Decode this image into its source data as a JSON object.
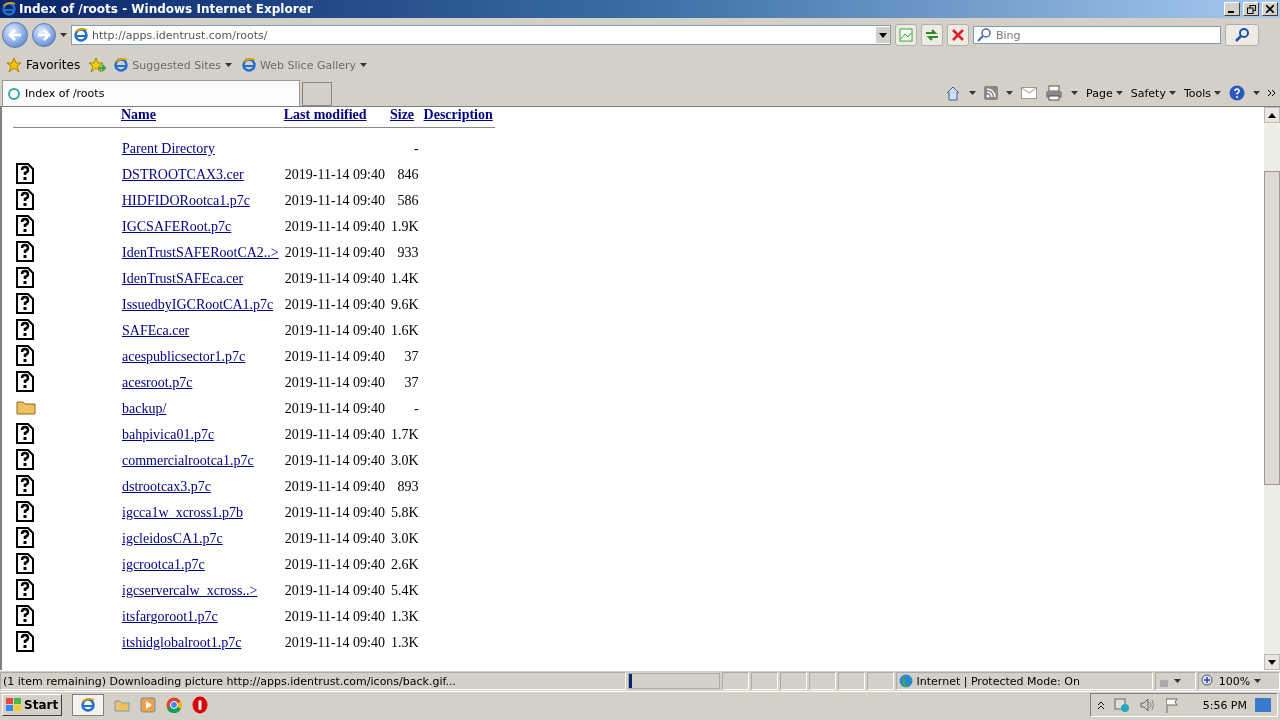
{
  "window": {
    "title": "Index of /roots - Windows Internet Explorer"
  },
  "address_bar": {
    "url": "http://apps.identrust.com/roots/"
  },
  "search": {
    "placeholder": "Bing"
  },
  "favorites_bar": {
    "favorites": "Favorites",
    "items": [
      {
        "label": "Suggested Sites"
      },
      {
        "label": "Web Slice Gallery"
      }
    ]
  },
  "tabs": [
    {
      "label": "Index of /roots",
      "selected": true
    }
  ],
  "command_bar": [
    "Page",
    "Safety",
    "Tools"
  ],
  "listing": {
    "columns": [
      "Name",
      "Last modified",
      "Size",
      "Description"
    ],
    "rows": [
      {
        "kind": "parent",
        "name": "Parent Directory",
        "modified": "",
        "size": "-"
      },
      {
        "kind": "file",
        "name": "DSTROOTCAX3.cer",
        "modified": "2019-11-14 09:40",
        "size": "846"
      },
      {
        "kind": "file",
        "name": "HIDFIDORootca1.p7c",
        "modified": "2019-11-14 09:40",
        "size": "586"
      },
      {
        "kind": "file",
        "name": "IGCSAFERoot.p7c",
        "modified": "2019-11-14 09:40",
        "size": "1.9K"
      },
      {
        "kind": "file",
        "name": "IdenTrustSAFERootCA2..>",
        "modified": "2019-11-14 09:40",
        "size": "933"
      },
      {
        "kind": "file",
        "name": "IdenTrustSAFEca.cer",
        "modified": "2019-11-14 09:40",
        "size": "1.4K"
      },
      {
        "kind": "file",
        "name": "IssuedbyIGCRootCA1.p7c",
        "modified": "2019-11-14 09:40",
        "size": "9.6K"
      },
      {
        "kind": "file",
        "name": "SAFEca.cer",
        "modified": "2019-11-14 09:40",
        "size": "1.6K"
      },
      {
        "kind": "file",
        "name": "acespublicsector1.p7c",
        "modified": "2019-11-14 09:40",
        "size": "37"
      },
      {
        "kind": "file",
        "name": "acesroot.p7c",
        "modified": "2019-11-14 09:40",
        "size": "37"
      },
      {
        "kind": "folder",
        "name": "backup/",
        "modified": "2019-11-14 09:40",
        "size": "-"
      },
      {
        "kind": "file",
        "name": "bahpivica01.p7c",
        "modified": "2019-11-14 09:40",
        "size": "1.7K"
      },
      {
        "kind": "file",
        "name": "commercialrootca1.p7c",
        "modified": "2019-11-14 09:40",
        "size": "3.0K"
      },
      {
        "kind": "file",
        "name": "dstrootcax3.p7c",
        "modified": "2019-11-14 09:40",
        "size": "893"
      },
      {
        "kind": "file",
        "name": "igcca1w_xcross1.p7b",
        "modified": "2019-11-14 09:40",
        "size": "5.8K"
      },
      {
        "kind": "file",
        "name": "igcleidosCA1.p7c",
        "modified": "2019-11-14 09:40",
        "size": "3.0K"
      },
      {
        "kind": "file",
        "name": "igcrootca1.p7c",
        "modified": "2019-11-14 09:40",
        "size": "2.6K"
      },
      {
        "kind": "file",
        "name": "igcservercalw_xcross..>",
        "modified": "2019-11-14 09:40",
        "size": "5.4K"
      },
      {
        "kind": "file",
        "name": "itsfargoroot1.p7c",
        "modified": "2019-11-14 09:40",
        "size": "1.3K"
      },
      {
        "kind": "file",
        "name": "itshidglobalroot1.p7c",
        "modified": "2019-11-14 09:40",
        "size": "1.3K"
      }
    ]
  },
  "status_bar": {
    "message": "(1 item remaining) Downloading picture http://apps.identrust.com/icons/back.gif...",
    "progress": {
      "level": 0.03
    },
    "zone": "Internet | Protected Mode: On",
    "zoom": "100%"
  },
  "taskbar": {
    "start": "Start",
    "clock": "5:56 PM"
  }
}
